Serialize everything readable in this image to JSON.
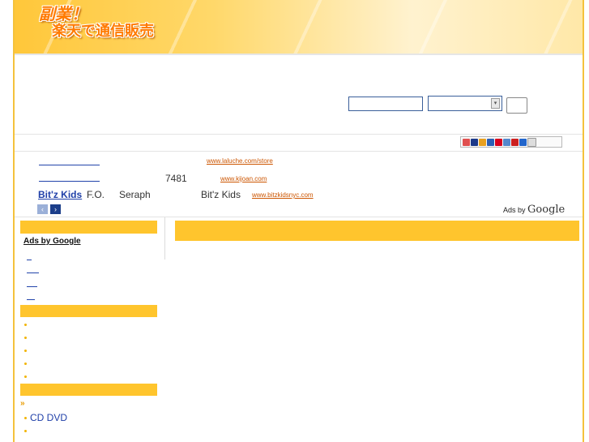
{
  "banner": {
    "logo_line1": "副業！",
    "logo_line2": "楽天で通信販売"
  },
  "ads": [
    {
      "url": "www.laluche.com/store"
    },
    {
      "num": "7481",
      "url": "www.kijoan.com"
    },
    {
      "title": "Bit'z Kids",
      "text1": "F.O.",
      "text2": "Seraph",
      "text3": "Bit'z Kids",
      "url": "www.bitzkidsnyc.com"
    }
  ],
  "ads_footer": {
    "prefix": "Ads by",
    "brand": "Google"
  },
  "nav": {
    "prev_icon": "‹",
    "next_icon": "›"
  },
  "sidebar": {
    "ads_link": "Ads by Google",
    "cd_dvd": "CD DVD",
    "arrow_icon": "»"
  },
  "colors": {
    "accent": "#ffc52d",
    "link": "#1f3fa8",
    "url": "#cc5500"
  }
}
